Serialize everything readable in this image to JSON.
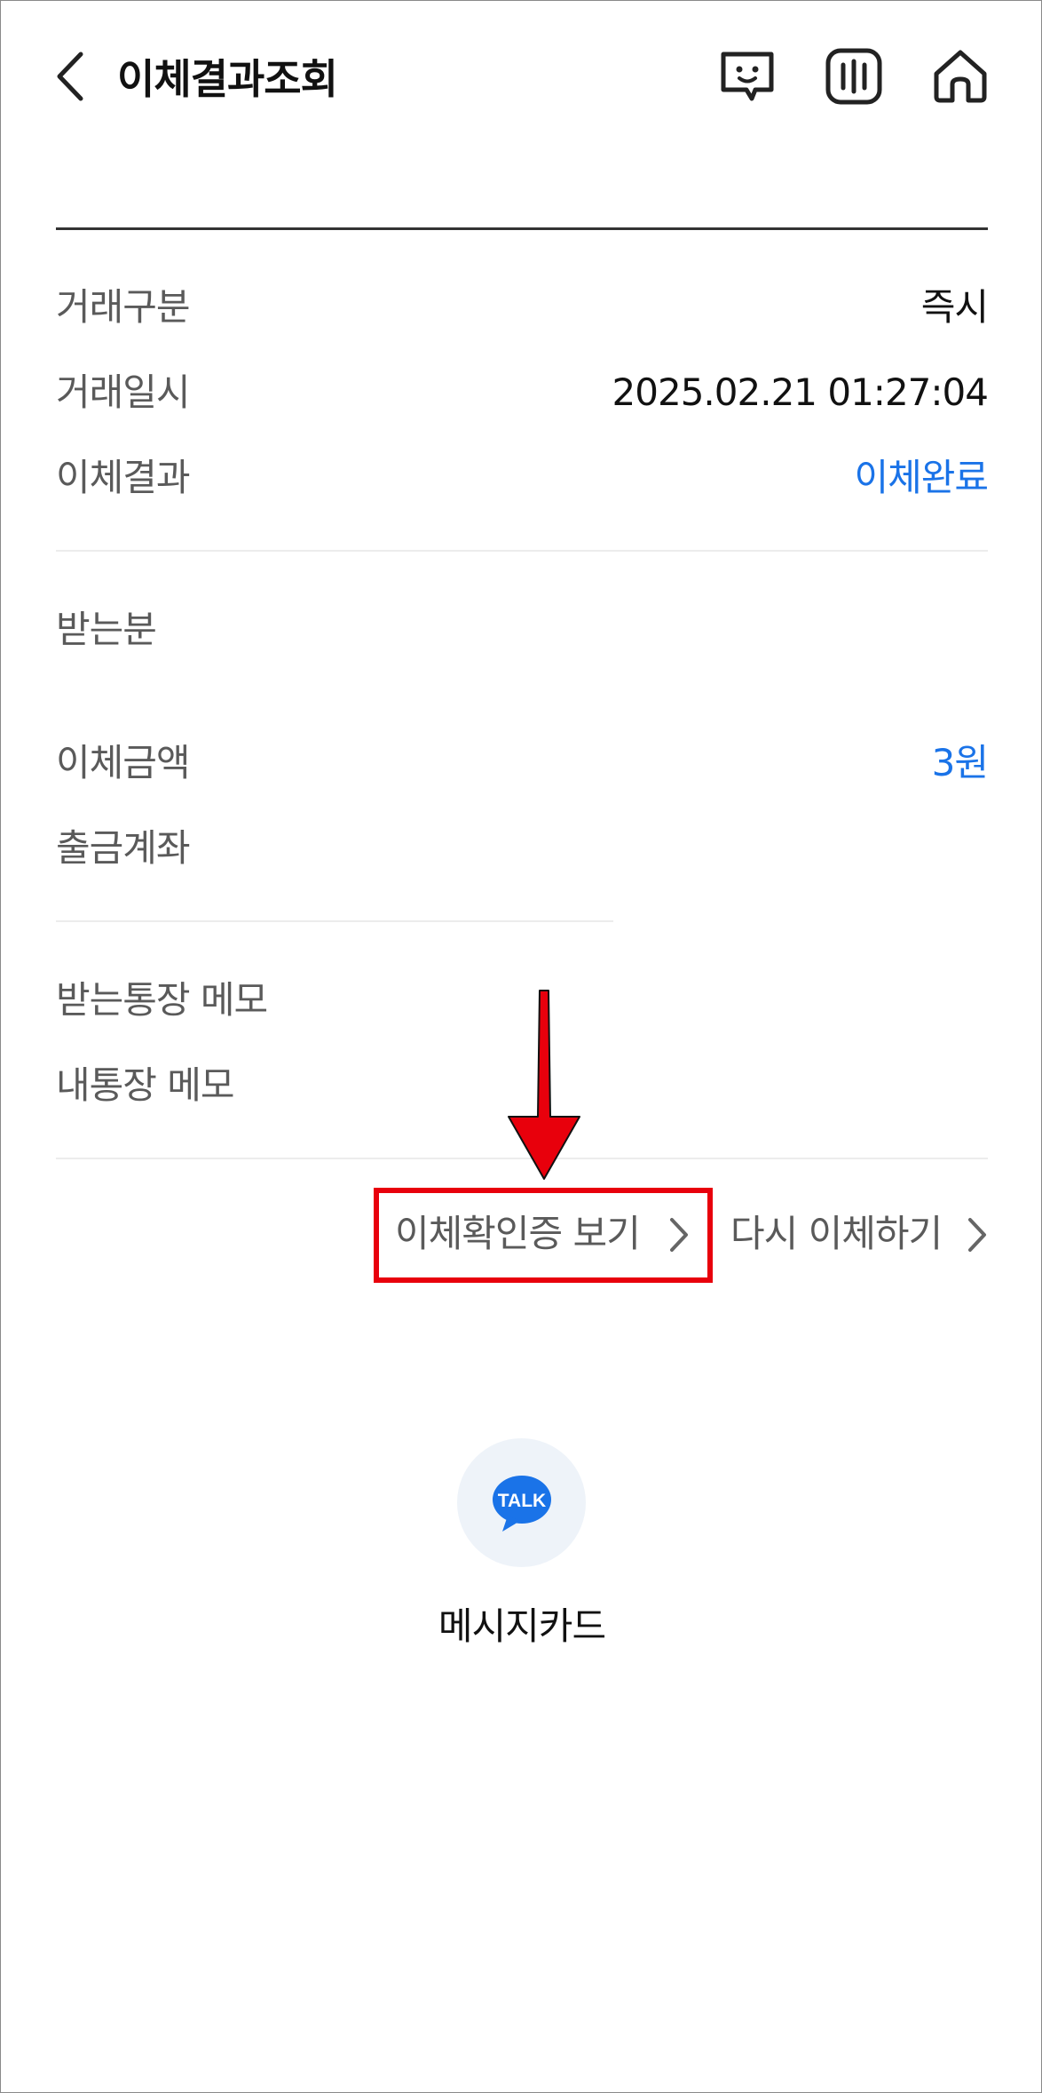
{
  "header": {
    "title": "이체결과조회",
    "back_icon": "chevron-left-icon",
    "icons": [
      "chatbot-icon",
      "menu-icon",
      "home-icon"
    ]
  },
  "details": {
    "transaction_type": {
      "label": "거래구분",
      "value": "즉시"
    },
    "transaction_datetime": {
      "label": "거래일시",
      "value": "2025.02.21 01:27:04"
    },
    "transfer_result": {
      "label": "이체결과",
      "value": "이체완료"
    },
    "recipient": {
      "label": "받는분",
      "value": ""
    },
    "transfer_amount": {
      "label": "이체금액",
      "value": "3원"
    },
    "withdrawal_account": {
      "label": "출금계좌",
      "value": ""
    },
    "recipient_memo": {
      "label": "받는통장 메모",
      "value": ""
    },
    "my_memo": {
      "label": "내통장 메모",
      "value": ""
    }
  },
  "actions": {
    "view_confirmation": "이체확인증 보기",
    "transfer_again": "다시 이체하기"
  },
  "share": {
    "talk_badge": "TALK",
    "message_card_label": "메시지카드"
  },
  "colors": {
    "accent_blue": "#1a73e8",
    "highlight_red": "#e8000c",
    "talk_blue": "#1a73e8"
  }
}
